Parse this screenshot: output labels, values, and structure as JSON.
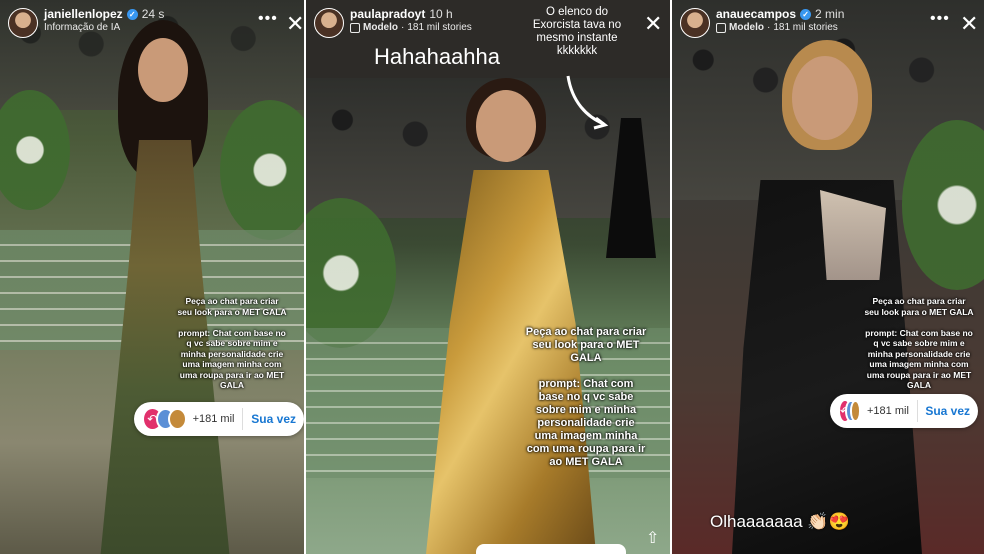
{
  "panels": [
    {
      "username": "janiellenlopez",
      "time": "24 s",
      "subtitle": "Informação de IA",
      "caption": "Peça ao chat para criar\nseu look para o MET GALA\n\nprompt: Chat com base no\nq vc sabe sobre mim e\nminha personalidade crie\numa imagem minha com\numa roupa para ir ao MET\nGALA",
      "reply_count": "+181 mil",
      "reply_button": "Sua vez"
    },
    {
      "username": "paulapradoyt",
      "time": "10 h",
      "subtitle_bold": "Modelo",
      "subtitle": "181 mil stories",
      "header_text": "Hahahaahha",
      "note": "O elenco do\nExorcista tava no\nmesmo instante\nkkkkkkk",
      "caption": "Peça ao chat para criar\nseu look para o MET\nGALA\n\nprompt: Chat com\nbase no q vc sabe\nsobre mim e minha\npersonalidade crie\numa imagem minha\ncom uma roupa para ir\nao MET GALA"
    },
    {
      "username": "anauecampos",
      "time": "2 min",
      "subtitle_bold": "Modelo",
      "subtitle": "181 mil stories",
      "caption": "Peça ao chat para criar\nseu look para o MET GALA\n\nprompt: Chat com base no\nq vc sabe sobre mim e\nminha personalidade crie\numa imagem minha com\numa roupa para ir ao MET\nGALA",
      "reply_count": "+181 mil",
      "reply_button": "Sua vez",
      "bottom_text": "Olhaaaaaaa 👏🏻😍"
    }
  ],
  "icons": {
    "more": "•••",
    "close": "✕",
    "upload": "⇧",
    "verified": "✓",
    "share": "↶"
  },
  "colors": {
    "accent_blue": "#1877d2",
    "verified_blue": "#3897f0",
    "share_pink": "#e1306c"
  }
}
